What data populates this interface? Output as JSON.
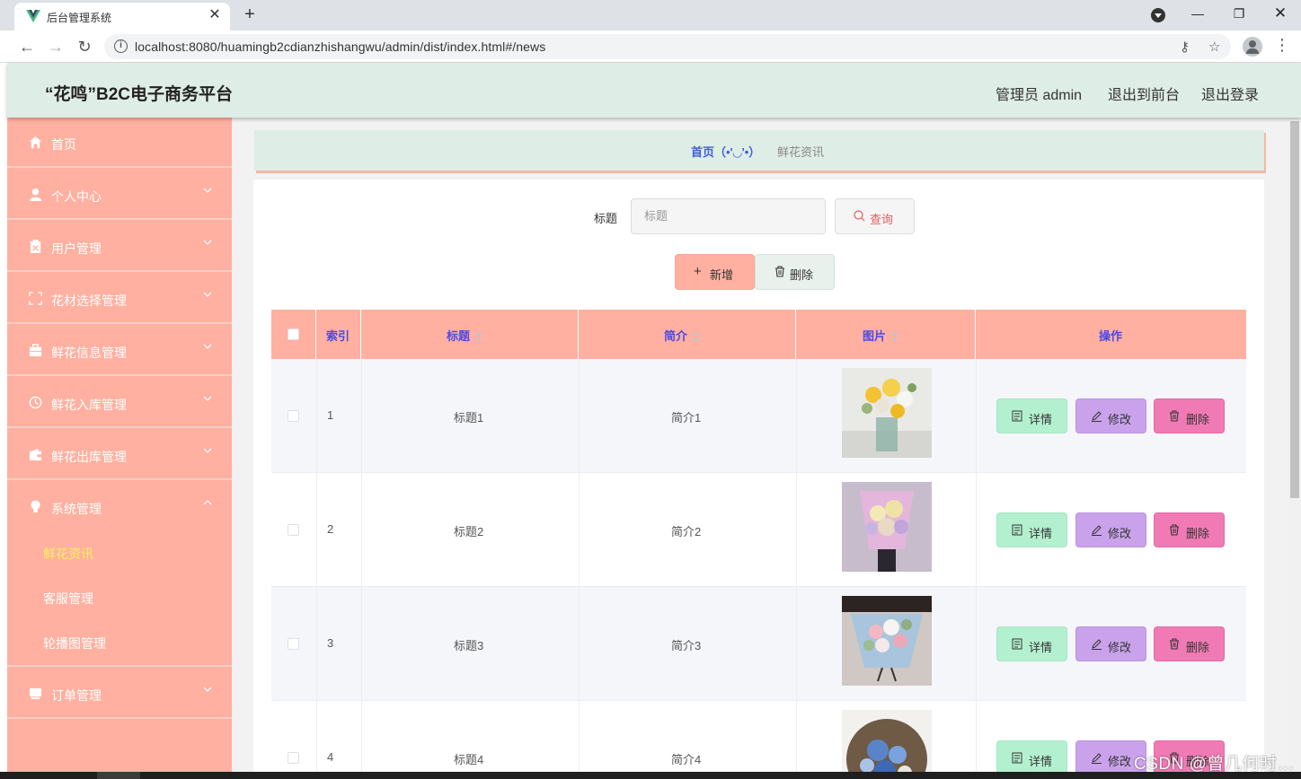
{
  "browser": {
    "tab_title": "后台管理系统",
    "url": "localhost:8080/huamingb2cdianzhishangwu/admin/dist/index.html#/news"
  },
  "header": {
    "brand": "“花鸣”B2C电子商务平台",
    "admin_label": "管理员 admin",
    "exit_frontend": "退出到前台",
    "logout": "退出登录"
  },
  "sidebar": {
    "items": [
      {
        "label": "首页",
        "icon": "home-icon"
      },
      {
        "label": "个人中心",
        "icon": "user-icon"
      },
      {
        "label": "用户管理",
        "icon": "clipboard-icon"
      },
      {
        "label": "花材选择管理",
        "icon": "fullscreen-icon"
      },
      {
        "label": "鲜花信息管理",
        "icon": "suitcase-icon"
      },
      {
        "label": "鲜花入库管理",
        "icon": "clock-icon"
      },
      {
        "label": "鲜花出库管理",
        "icon": "wallet-icon"
      },
      {
        "label": "系统管理",
        "icon": "bulb-icon"
      },
      {
        "label": "订单管理",
        "icon": "drawer-icon"
      }
    ],
    "sub_items": [
      {
        "label": "鲜花资讯"
      },
      {
        "label": "客服管理"
      },
      {
        "label": "轮播图管理"
      }
    ],
    "active_sub_color": "#f7f35a"
  },
  "breadcrumb": {
    "home": "首页（•'◡'•）",
    "current": "鲜花资讯"
  },
  "search": {
    "label": "标题",
    "placeholder": "标题",
    "query_button": "查询"
  },
  "actions": {
    "add": "新增",
    "delete": "删除"
  },
  "table": {
    "headers": [
      "索引",
      "标题",
      "简介",
      "图片",
      "操作"
    ],
    "rows": [
      {
        "index": "1",
        "title": "标题1",
        "intro": "简介1"
      },
      {
        "index": "2",
        "title": "标题2",
        "intro": "简介2"
      },
      {
        "index": "3",
        "title": "标题3",
        "intro": "简介3"
      },
      {
        "index": "4",
        "title": "标题4",
        "intro": "简介4"
      }
    ],
    "buttons": {
      "detail": "详情",
      "edit": "修改",
      "delete": "删除"
    }
  },
  "colors": {
    "sidebar": "#ffb0a0",
    "header": "#deede5",
    "header_text": "#4b4be0",
    "detail": "#b3f0cf",
    "edit": "#c9a2eb",
    "delete": "#f07ab4"
  },
  "watermark": "CSDN @曾几何时…"
}
